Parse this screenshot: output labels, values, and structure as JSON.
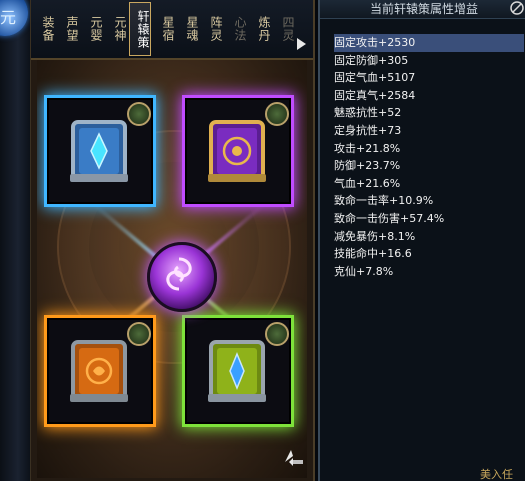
{
  "left_bar": {
    "orb_icon": "sphere-icon"
  },
  "tabs": [
    {
      "label": "装备",
      "state": "normal"
    },
    {
      "label": "声望",
      "state": "normal"
    },
    {
      "label": "元婴",
      "state": "normal"
    },
    {
      "label": "元神",
      "state": "normal"
    },
    {
      "label": "轩辕策",
      "state": "active"
    },
    {
      "label": "星宿",
      "state": "normal"
    },
    {
      "label": "星魂",
      "state": "normal"
    },
    {
      "label": "阵灵",
      "state": "normal"
    },
    {
      "label": "心法",
      "state": "dim"
    },
    {
      "label": "炼丹",
      "state": "normal"
    },
    {
      "label": "四灵",
      "state": "dim"
    }
  ],
  "slots": [
    {
      "name": "blue",
      "color": "#3fb6ff",
      "book_color": "#3a7cc6",
      "gem_color": "#49e4ff"
    },
    {
      "name": "purple",
      "color": "#c04cff",
      "book_color": "#7a2cc0",
      "gem_color": "#e8b84c"
    },
    {
      "name": "orange",
      "color": "#ff9a1a",
      "book_color": "#d66a12",
      "gem_color": "#ffb14a"
    },
    {
      "name": "green",
      "color": "#7ee23a",
      "book_color": "#8fb21a",
      "gem_color": "#3aa0ff"
    }
  ],
  "tooltip": {
    "title": "当前轩辕策属性增益",
    "close_icon": "close-icon",
    "attributes": [
      "固定攻击+2530",
      "固定防御+305",
      "固定气血+5107",
      "固定真气+2584",
      "魅惑抗性+52",
      "定身抗性+73",
      "攻击+21.8%",
      "防御+23.7%",
      "气血+21.6%",
      "致命一击率+10.9%",
      "致命一击伤害+57.4%",
      "减免暴伤+8.1%",
      "技能命中+16.6",
      "克仙+7.8%"
    ]
  },
  "corner_icon": "feather-return-icon",
  "footer_fragment": "美入任"
}
